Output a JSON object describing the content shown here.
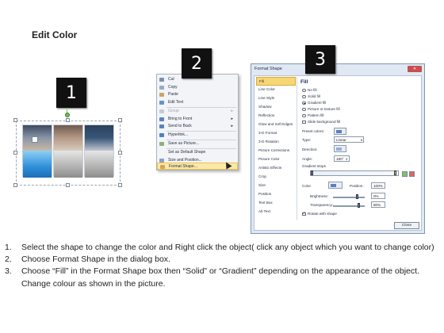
{
  "page": {
    "title": "Edit Color"
  },
  "steps": {
    "one": "1",
    "two": "2",
    "three": "3"
  },
  "context_menu": {
    "items": [
      {
        "label": "Cut",
        "icon": "scissors-icon",
        "underline": "t"
      },
      {
        "label": "Copy",
        "icon": "copy-icon"
      },
      {
        "label": "Paste",
        "icon": "paste-icon"
      },
      {
        "label": "Edit Text",
        "icon": "edit-text-icon"
      },
      {
        "label": "Group",
        "icon": "group-icon",
        "disabled": true,
        "submenu": true
      },
      {
        "label": "Bring to Front",
        "icon": "bring-front-icon",
        "submenu": true
      },
      {
        "label": "Send to Back",
        "icon": "send-back-icon",
        "submenu": true
      },
      {
        "label": "Hyperlink...",
        "icon": "hyperlink-icon"
      },
      {
        "label": "Save as Picture...",
        "icon": "picture-icon"
      },
      {
        "label": "Set as Default Shape",
        "icon": ""
      },
      {
        "label": "Size and Position...",
        "icon": "size-icon"
      },
      {
        "label": "Format Shape...",
        "icon": "format-shape-icon",
        "highlighted": true
      }
    ]
  },
  "dialog": {
    "title": "Format Shape",
    "close_label": "Close",
    "close_x": "✕",
    "nav": [
      "Fill",
      "Line Color",
      "Line Style",
      "Shadow",
      "Reflection",
      "Glow and Soft Edges",
      "3-D Format",
      "3-D Rotation",
      "Picture Corrections",
      "Picture Color",
      "Artistic Effects",
      "Crop",
      "Size",
      "Position",
      "Text Box",
      "Alt Text"
    ],
    "section_title": "Fill",
    "fill_options": [
      {
        "label": "No fill",
        "selected": false
      },
      {
        "label": "Solid fill",
        "selected": false
      },
      {
        "label": "Gradient fill",
        "selected": true
      },
      {
        "label": "Picture or texture fill",
        "selected": false
      },
      {
        "label": "Pattern fill",
        "selected": false
      }
    ],
    "slide_background_label": "Slide background fill",
    "preset_colors_label": "Preset colors:",
    "type_label": "Type:",
    "type_value": "Linear",
    "direction_label": "Direction:",
    "angle_label": "Angle:",
    "angle_value": "180°",
    "gradient_stops_label": "Gradient stops",
    "color_label": "Color",
    "position_label": "Position:",
    "position_value": "100%",
    "brightness_label": "Brightness:",
    "brightness_value": "0%",
    "transparency_label": "Transparency:",
    "transparency_value": "80%",
    "rotate_label": "Rotate with shape"
  },
  "instructions": [
    {
      "n": "1.",
      "text": "Select the shape to change the color and Right click the object( click any object which you want to change color)"
    },
    {
      "n": "2.",
      "text": "Choose Format Shape in the dialog box."
    },
    {
      "n": "3.",
      "text": "Choose “Fill” in the Format Shape box then “Solid” or “Gradient” depending on the appearance of the object. Change colour as shown in the picture."
    }
  ],
  "colors": {
    "accent_blue": "#3c8fd6",
    "menu_highlight": "#fbe8a6",
    "dialog_frame": "#dfe8f3",
    "badge": "#111111"
  }
}
